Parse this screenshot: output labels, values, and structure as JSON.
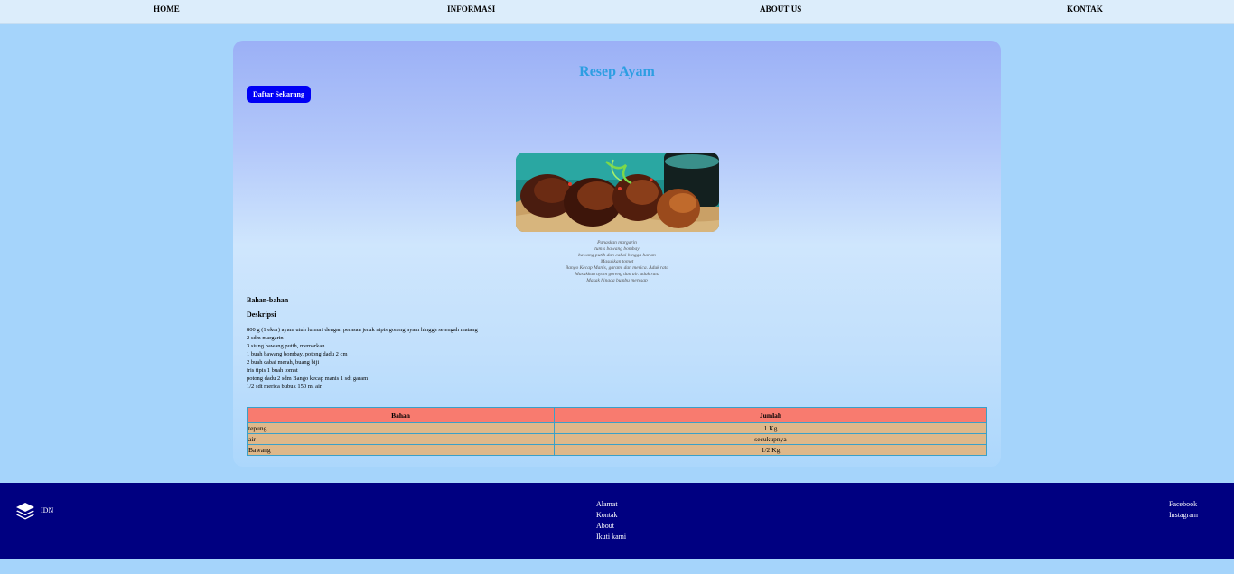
{
  "nav": {
    "home": "HOME",
    "informasi": "INFORMASI",
    "about": "ABOUT US",
    "kontak": "KONTAK"
  },
  "card": {
    "title": "Resep Ayam",
    "button_label": "Daftar Sekarang",
    "image": "fried-chicken-photo",
    "caption_lines": [
      "Panaskan margarin",
      "tumis bawang bombay",
      "bawang putih dan cabai hingga harum",
      "Masukkan tomat",
      "Bango Kecap Manis, garam, dan merica. Aduk rata",
      "Masukkan ayam goreng dan air. aduk rata",
      "Masak hingga bumbu meresap"
    ],
    "heading_bahan": "Bahan-bahan",
    "heading_deskripsi": "Deskripsi",
    "description_lines": [
      "800 g (1 ekor) ayam utuh lumuri dengan perasan jeruk nipis goreng ayam hingga setengah matang",
      "2 sdm margarin",
      "3 siung bawang putih, memarkan",
      "1 buah bawang bombay, potong dadu 2 cm",
      "2 buah cabai merah, buang biji",
      "iris tipis 1 buah tomat",
      "potong dadu 2 sdm Bango kecap manis 1 sdt garam",
      "1/2 sdt merica bubuk 150 ml air"
    ]
  },
  "table": {
    "headers": [
      "Bahan",
      "Jumlah"
    ],
    "rows": [
      [
        "tepung",
        "1 Kg"
      ],
      [
        "air",
        "secukupnya"
      ],
      [
        "Bawang",
        "1/2 Kg"
      ]
    ]
  },
  "footer": {
    "brand": "IDN",
    "logo_icon": "layers-icon",
    "links": [
      "Alamat",
      "Kontak",
      "About",
      "Ikuti kami"
    ],
    "social": [
      "Facebook",
      "Instagram"
    ]
  },
  "colors": {
    "page_bg": "#a5d4fb",
    "nav_bg": "#dcedfb",
    "title": "#2d9ee2",
    "button": "#0000f5",
    "table_header": "#f87b6f",
    "table_cell": "#deb88a",
    "footer_bg": "#000081"
  }
}
